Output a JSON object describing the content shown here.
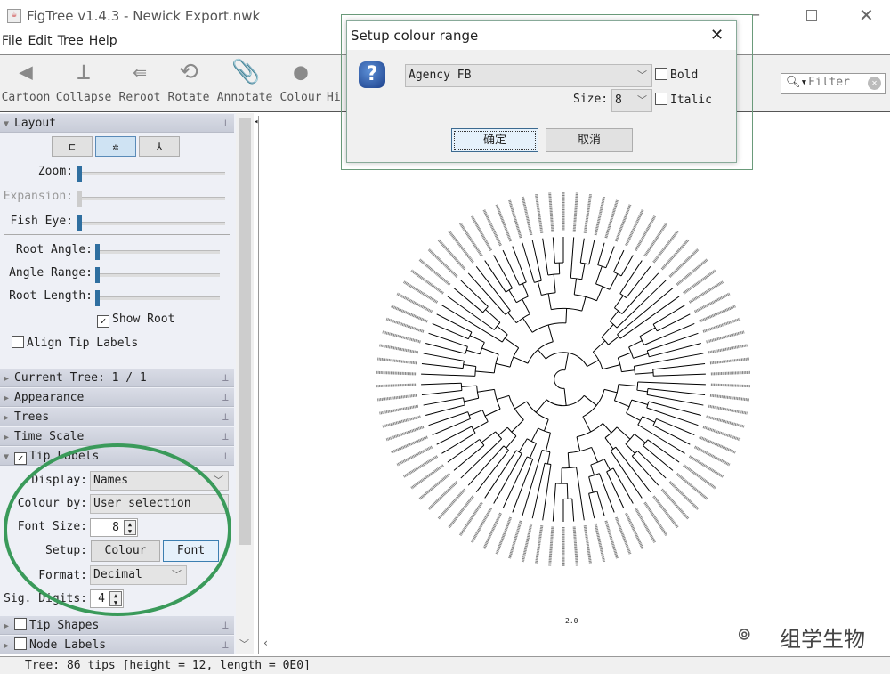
{
  "window": {
    "title": "FigTree v1.4.3 - Newick Export.nwk",
    "controls": [
      "minimize",
      "maximize",
      "close"
    ]
  },
  "menu": [
    "File",
    "Edit",
    "Tree",
    "Help"
  ],
  "toolbar": [
    {
      "label": "Cartoon",
      "icon": "cartoon-icon"
    },
    {
      "label": "Collapse",
      "icon": "collapse-icon"
    },
    {
      "label": "Reroot",
      "icon": "reroot-icon"
    },
    {
      "label": "Rotate",
      "icon": "rotate-icon"
    },
    {
      "label": "Annotate",
      "icon": "paperclip-icon"
    },
    {
      "label": "Colour",
      "icon": "circle-icon"
    },
    {
      "label": "Hi",
      "icon": "highlight-icon"
    }
  ],
  "filter": {
    "placeholder": "Filter"
  },
  "layout": {
    "header": "Layout",
    "zoom": "Zoom:",
    "expansion": "Expansion:",
    "fish_eye": "Fish Eye:",
    "root_angle": "Root Angle:",
    "angle_range": "Angle Range:",
    "root_length": "Root Length:",
    "show_root": "Show Root",
    "show_root_checked": true,
    "align_tip_labels": "Align Tip Labels",
    "align_checked": false,
    "selected_layout": "radial"
  },
  "panels": [
    {
      "label": "Current Tree: 1 / 1"
    },
    {
      "label": "Appearance"
    },
    {
      "label": "Trees"
    },
    {
      "label": "Time Scale"
    }
  ],
  "tip_labels": {
    "header": "Tip Labels",
    "checked": true,
    "display_label": "Display:",
    "display": "Names",
    "colour_by_label": "Colour by:",
    "colour_by": "User selection",
    "font_size_label": "Font Size:",
    "font_size": "8",
    "setup_label": "Setup:",
    "colour_button": "Colour",
    "font_button": "Font",
    "format_label": "Format:",
    "format": "Decimal",
    "sig_digits_label": "Sig. Digits:",
    "sig_digits": "4"
  },
  "tip_shapes": "Tip Shapes",
  "node_labels": "Node Labels",
  "status": "Tree: 86 tips [height = 12, length = 0E0]",
  "scale_bar": "2.0",
  "watermark": "组学生物",
  "dialog": {
    "title": "Setup colour range",
    "font": "Agency FB",
    "bold": "Bold",
    "italic": "Italic",
    "size_label": "Size:",
    "size": "8",
    "ok": "确定",
    "cancel": "取消"
  },
  "colors": {
    "highlight_ellipse": "#3a9a5a",
    "slider_thumb": "#2f6fa0"
  }
}
